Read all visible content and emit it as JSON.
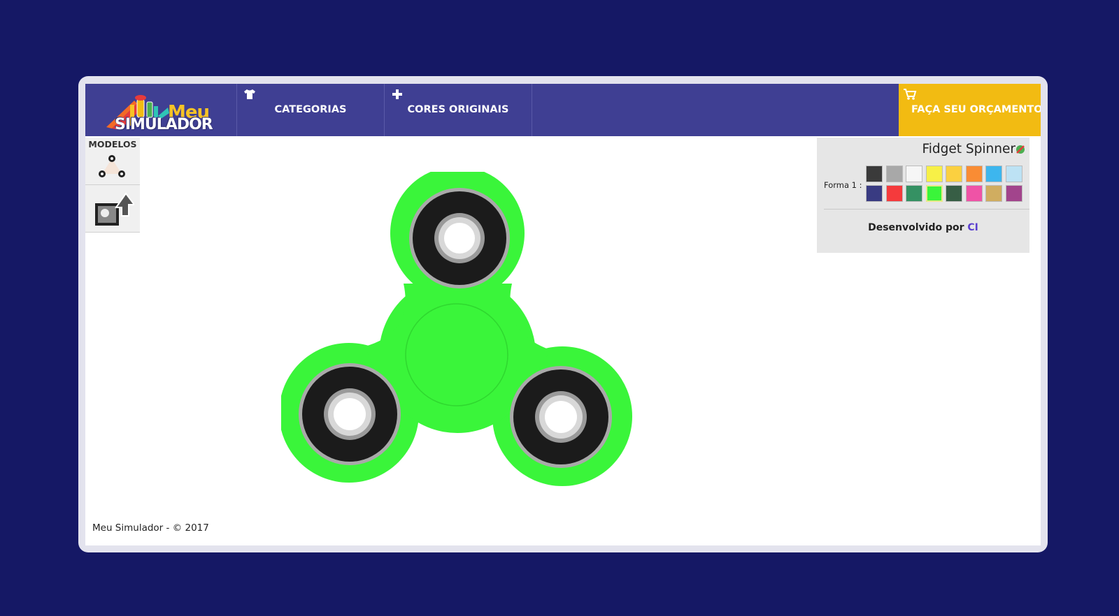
{
  "logo": {
    "line1": "Meu",
    "line2": "SIMULADOR"
  },
  "nav": {
    "categorias": "CATEGORIAS",
    "cores": "CORES ORIGINAIS",
    "orcamento": "FAÇA SEU ORÇAMENTO"
  },
  "models": {
    "title": "MODELOS"
  },
  "panel": {
    "title": "Fidget Spinner",
    "forma_label": "Forma 1 :",
    "swatches": [
      "#3a3a3a",
      "#a8a8a8",
      "#f6f6f6",
      "#f7f047",
      "#fbd040",
      "#f98c34",
      "#3db6ee",
      "#bde2f4",
      "#393b82",
      "#f53a3c",
      "#359163",
      "#3af53a",
      "#375e45",
      "#ef53a6",
      "#d0ad60",
      "#a2448c"
    ],
    "selected_swatch": 11,
    "credit_prefix": "Desenvolvido por ",
    "credit_link": "CI"
  },
  "spinner": {
    "body_color": "#3af53a"
  },
  "footer": {
    "text": "Meu Simulador - © 2017"
  },
  "colors": {
    "background": "#151865",
    "nav": "#3f3f93",
    "cta": "#f2bb12"
  }
}
